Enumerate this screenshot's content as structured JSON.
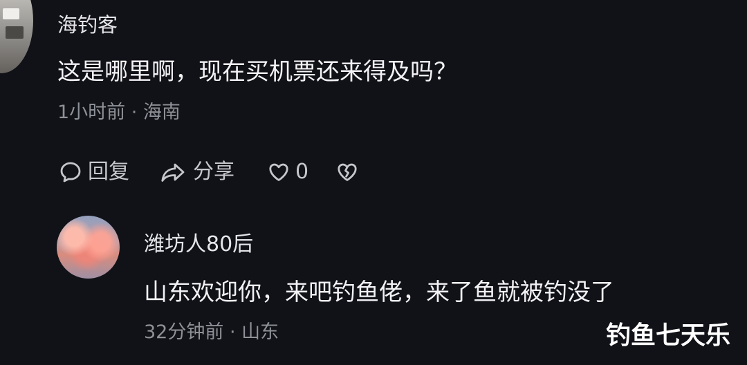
{
  "post": {
    "username": "海钓客",
    "text": "这是哪里啊，现在买机票还来得及吗？",
    "meta": "1小时前 · 海南",
    "actions": {
      "reply": {
        "label": "回复",
        "icon": "speech-bubble-icon"
      },
      "share": {
        "label": "分享",
        "icon": "share-arrow-icon"
      },
      "like": {
        "count": "0",
        "icon": "heart-icon"
      },
      "dislike": {
        "icon": "broken-heart-icon"
      }
    }
  },
  "reply": {
    "username": "潍坊人80后",
    "text": "山东欢迎你，来吧钓鱼佬，来了鱼就被钓没了",
    "meta": "32分钟前 · 山东"
  },
  "watermark": "钓鱼七天乐",
  "colors": {
    "background": "#111217",
    "primary_text": "#f3f3f6",
    "secondary_text": "#8f9198",
    "icon_text": "#c6c7cc"
  }
}
